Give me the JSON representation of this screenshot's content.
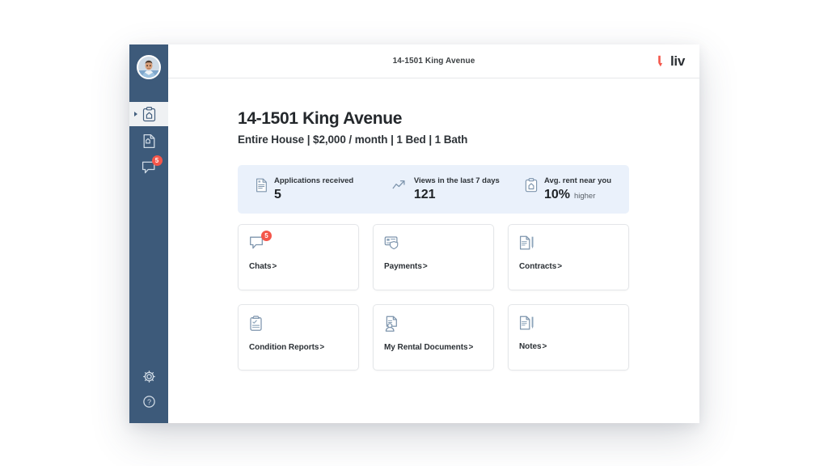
{
  "window": {
    "topbar": {
      "title": "14-1501 King Avenue",
      "brand_text": "liv",
      "brand_mark_color": "#f4564a"
    },
    "sidebar": {
      "avatar_name": "user-avatar",
      "accent_color": "#3d5a7a",
      "items": [
        {
          "name": "sidebar-item-properties",
          "icon": "clipboard-home-icon",
          "active": true,
          "badge": ""
        },
        {
          "name": "sidebar-item-documents",
          "icon": "document-home-icon",
          "active": false,
          "badge": ""
        },
        {
          "name": "sidebar-item-chats",
          "icon": "chat-bubble-icon",
          "active": false,
          "badge": "5"
        }
      ],
      "bottom_items": [
        {
          "name": "sidebar-item-settings",
          "icon": "gear-icon"
        },
        {
          "name": "sidebar-item-help",
          "icon": "question-circle-icon"
        }
      ]
    }
  },
  "page": {
    "title": "14-1501 King Avenue",
    "subtitle": "Entire House | $2,000 / month | 1 Bed | 1 Bath"
  },
  "stats": {
    "background_color": "#eaf1fb",
    "items": [
      {
        "icon": "document-list-icon",
        "label": "Applications received",
        "value": "5",
        "suffix": ""
      },
      {
        "icon": "trending-up-icon",
        "label": "Views in the last 7 days",
        "value": "121",
        "suffix": ""
      },
      {
        "icon": "clipboard-home-icon",
        "label": "Avg. rent near you",
        "value": "10%",
        "suffix": "higher"
      }
    ]
  },
  "cards": [
    {
      "label": "Chats",
      "chevron": ">",
      "icon": "chat-bubble-icon",
      "badge": "5",
      "name": "card-chats"
    },
    {
      "label": "Payments",
      "chevron": ">",
      "icon": "payment-card-shield-icon",
      "badge": "",
      "name": "card-payments"
    },
    {
      "label": "Contracts",
      "chevron": ">",
      "icon": "contract-pen-icon",
      "badge": "",
      "name": "card-contracts"
    },
    {
      "label": "Condition Reports",
      "chevron": ">",
      "icon": "clipboard-check-icon",
      "badge": "",
      "name": "card-condition-reports"
    },
    {
      "label": "My Rental Documents",
      "chevron": ">",
      "icon": "document-person-icon",
      "badge": "",
      "name": "card-my-rental-documents"
    },
    {
      "label": "Notes",
      "chevron": ">",
      "icon": "notes-pen-icon",
      "badge": "",
      "name": "card-notes"
    }
  ]
}
